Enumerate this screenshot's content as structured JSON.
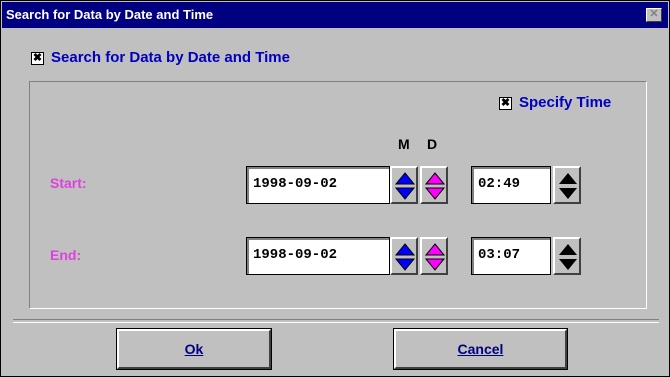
{
  "window": {
    "title": "Search for Data by Date and Time",
    "close_glyph": "✕"
  },
  "search_checkbox": {
    "checked": true,
    "mark": "✖",
    "label": "Search for Data by Date and Time"
  },
  "specify_time_checkbox": {
    "checked": true,
    "mark": "✖",
    "label": "Specify Time"
  },
  "spinner_headers": {
    "month": "M",
    "day": "D"
  },
  "start": {
    "label": "Start:",
    "date": "1998-09-02",
    "time": "02:49"
  },
  "end": {
    "label": "End:",
    "date": "1998-09-02",
    "time": "03:07"
  },
  "buttons": {
    "ok": "Ok",
    "cancel": "Cancel"
  },
  "colors": {
    "title_bar": "#000080",
    "accent_blue": "#0000c0",
    "accent_magenta": "#e040e0",
    "face": "#c0c0c0"
  },
  "icons": {
    "month_spinner": "up-down-arrows-icon",
    "day_spinner": "up-down-arrows-icon",
    "time_spinner": "up-down-arrows-icon"
  }
}
